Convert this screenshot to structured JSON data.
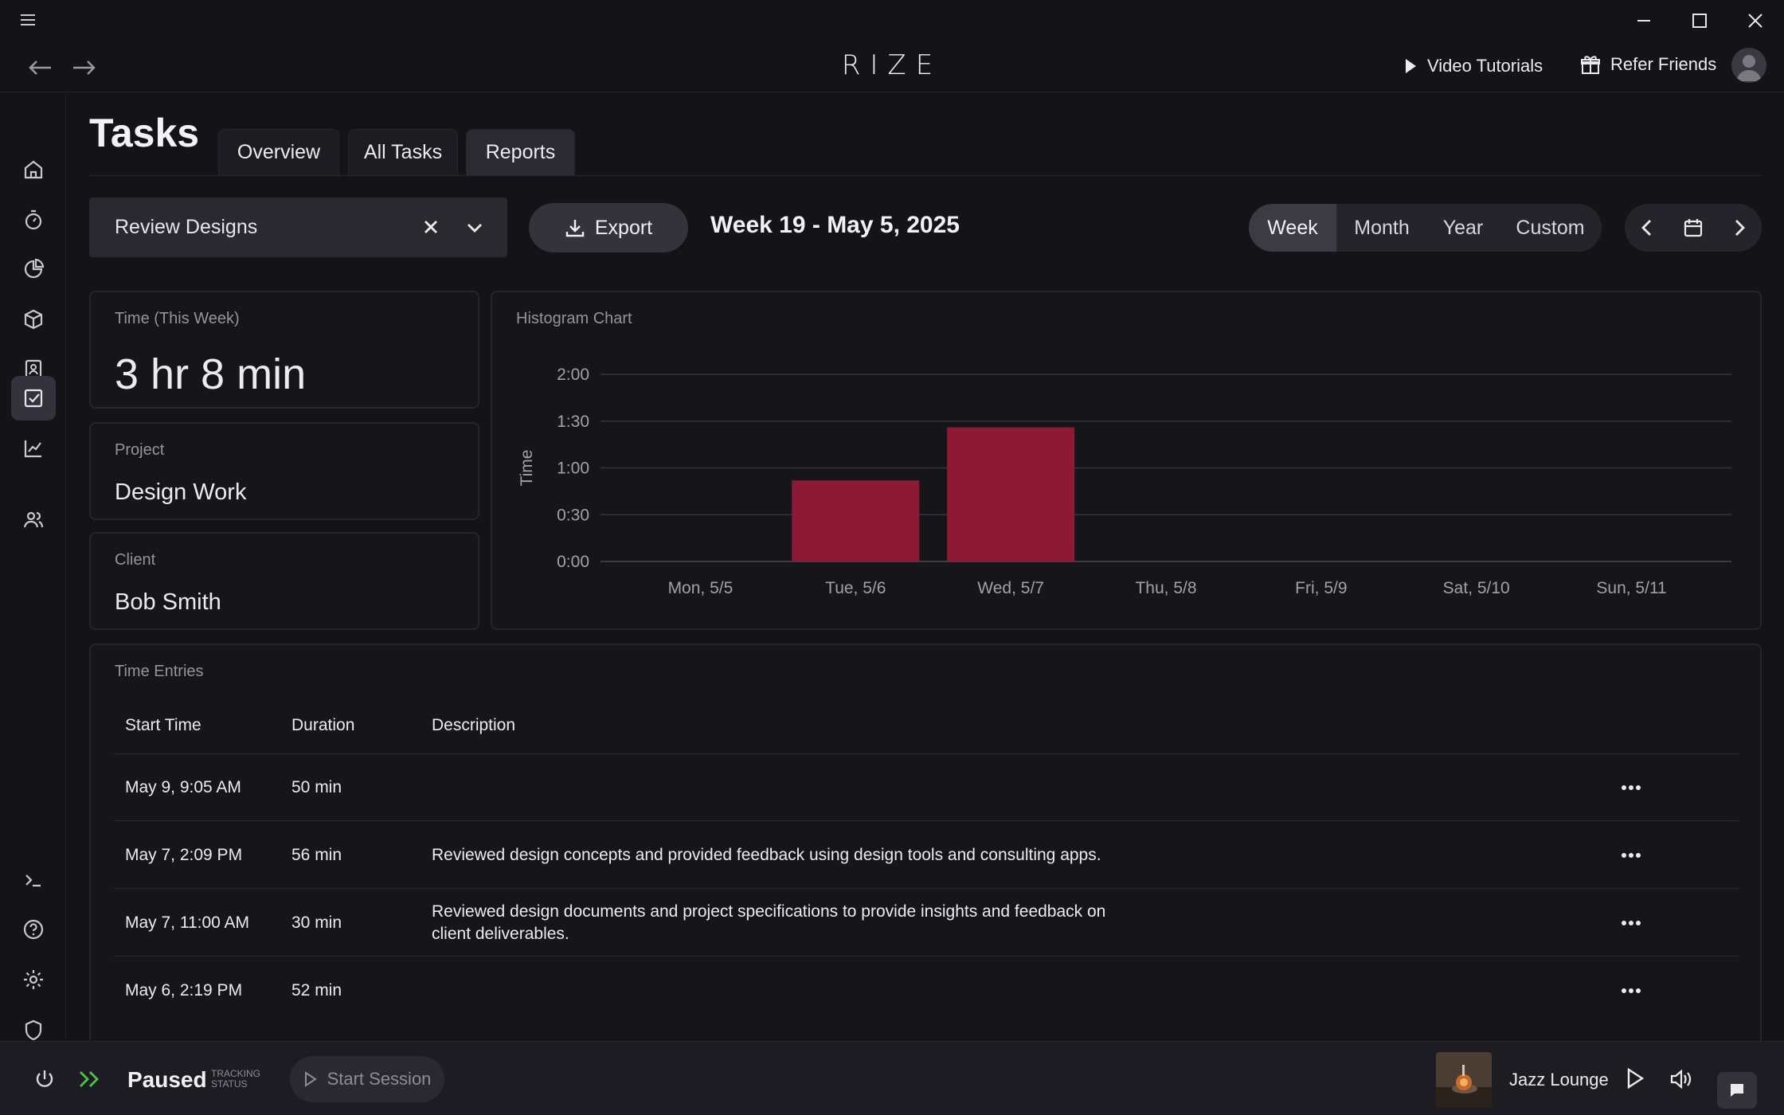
{
  "app": {
    "logo": "RIZE"
  },
  "header": {
    "video_tutorials": "Video Tutorials",
    "refer_friends": "Refer Friends"
  },
  "sidebar": {
    "items": [
      {
        "icon": "home-icon"
      },
      {
        "icon": "timer-icon"
      },
      {
        "icon": "pie-chart-icon"
      },
      {
        "icon": "box-icon"
      },
      {
        "icon": "contact-icon"
      },
      {
        "icon": "tasks-icon",
        "active": true
      },
      {
        "icon": "line-chart-icon"
      },
      {
        "icon": "users-icon"
      }
    ],
    "bottom": [
      {
        "icon": "terminal-icon"
      },
      {
        "icon": "help-icon"
      },
      {
        "icon": "gear-icon"
      },
      {
        "icon": "shield-icon"
      }
    ]
  },
  "page": {
    "title": "Tasks",
    "tabs": [
      {
        "label": "Overview",
        "active": false
      },
      {
        "label": "All Tasks",
        "active": false
      },
      {
        "label": "Reports",
        "active": true
      }
    ]
  },
  "toolbar": {
    "task_value": "Review Designs",
    "export_label": "Export",
    "week_label": "Week 19 - May 5, 2025",
    "ranges": [
      {
        "label": "Week",
        "active": true
      },
      {
        "label": "Month",
        "active": false
      },
      {
        "label": "Year",
        "active": false
      },
      {
        "label": "Custom",
        "active": false
      }
    ]
  },
  "summary": {
    "time_label": "Time (This Week)",
    "time_value": "3 hr 8 min",
    "project_label": "Project",
    "project_value": "Design Work",
    "client_label": "Client",
    "client_value": "Bob Smith"
  },
  "histogram": {
    "card_title": "Histogram Chart"
  },
  "chart_data": {
    "type": "bar",
    "categories": [
      "Mon, 5/5",
      "Tue, 5/6",
      "Wed, 5/7",
      "Thu, 5/8",
      "Fri, 5/9",
      "Sat, 5/10",
      "Sun, 5/11"
    ],
    "values": [
      0,
      52,
      86,
      0,
      0,
      0,
      0
    ],
    "value_units": "minutes",
    "ylabel": "Time",
    "yticks": [
      "0:00",
      "0:30",
      "1:00",
      "1:30",
      "2:00"
    ],
    "ylim": [
      0,
      120
    ],
    "grid": true,
    "bar_color": "#8c1a34"
  },
  "entries": {
    "title": "Time Entries",
    "columns": [
      "Start Time",
      "Duration",
      "Description"
    ],
    "rows": [
      {
        "start": "May 9, 9:05 AM",
        "duration": "50 min",
        "description": ""
      },
      {
        "start": "May 7, 2:09 PM",
        "duration": "56 min",
        "description": "Reviewed design concepts and provided feedback using design tools and consulting apps."
      },
      {
        "start": "May 7, 11:00 AM",
        "duration": "30 min",
        "description": "Reviewed design documents and project specifications to provide insights and feedback on client deliverables."
      },
      {
        "start": "May 6, 2:19 PM",
        "duration": "52 min",
        "description": ""
      }
    ]
  },
  "footer": {
    "status": "Paused",
    "status_caption_1": "TRACKING",
    "status_caption_2": "STATUS",
    "start_session": "Start Session",
    "music_title": "Jazz Lounge"
  },
  "colors": {
    "accent_bar": "#8c1a34",
    "status_green": "#4cc44a",
    "background": "#141318"
  }
}
